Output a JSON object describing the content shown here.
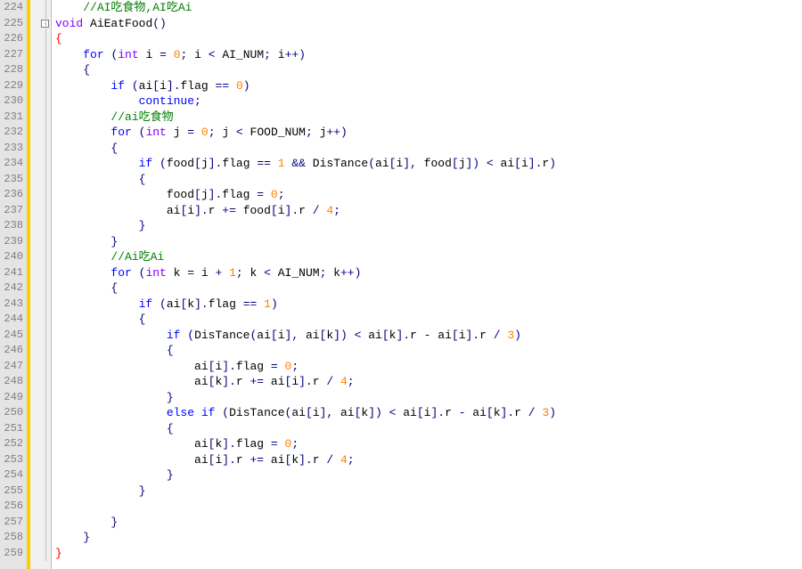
{
  "lineStart": 224,
  "lineEnd": 259,
  "code": {
    "l224": {
      "indent": 1,
      "tokens": [
        {
          "t": "//AI吃食物,AI吃Ai",
          "c": "cmt"
        }
      ]
    },
    "l225": {
      "indent": 0,
      "tokens": [
        {
          "t": "void",
          "c": "type"
        },
        {
          "t": " "
        },
        {
          "t": "AiEatFood",
          "c": "ident"
        },
        {
          "t": "()",
          "c": "paren"
        }
      ]
    },
    "l226": {
      "indent": 0,
      "tokens": [
        {
          "t": "{",
          "c": "br-red"
        }
      ]
    },
    "l227": {
      "indent": 1,
      "tokens": [
        {
          "t": "for",
          "c": "kw"
        },
        {
          "t": " "
        },
        {
          "t": "(",
          "c": "paren"
        },
        {
          "t": "int",
          "c": "type"
        },
        {
          "t": " i "
        },
        {
          "t": "=",
          "c": "op"
        },
        {
          "t": " "
        },
        {
          "t": "0",
          "c": "num"
        },
        {
          "t": ";",
          "c": "punc"
        },
        {
          "t": " i "
        },
        {
          "t": "<",
          "c": "op"
        },
        {
          "t": " AI_NUM"
        },
        {
          "t": ";",
          "c": "punc"
        },
        {
          "t": " i"
        },
        {
          "t": "++)",
          "c": "paren"
        }
      ]
    },
    "l228": {
      "indent": 1,
      "tokens": [
        {
          "t": "{",
          "c": "brace"
        }
      ]
    },
    "l229": {
      "indent": 2,
      "tokens": [
        {
          "t": "if",
          "c": "kw"
        },
        {
          "t": " "
        },
        {
          "t": "(",
          "c": "paren"
        },
        {
          "t": "ai"
        },
        {
          "t": "[",
          "c": "punc"
        },
        {
          "t": "i"
        },
        {
          "t": "].",
          "c": "punc"
        },
        {
          "t": "flag "
        },
        {
          "t": "==",
          "c": "op"
        },
        {
          "t": " "
        },
        {
          "t": "0",
          "c": "num"
        },
        {
          "t": ")",
          "c": "paren"
        }
      ]
    },
    "l230": {
      "indent": 3,
      "tokens": [
        {
          "t": "continue",
          "c": "kw"
        },
        {
          "t": ";",
          "c": "punc"
        }
      ]
    },
    "l231": {
      "indent": 2,
      "tokens": [
        {
          "t": "//ai吃食物",
          "c": "cmt"
        }
      ]
    },
    "l232": {
      "indent": 2,
      "tokens": [
        {
          "t": "for",
          "c": "kw"
        },
        {
          "t": " "
        },
        {
          "t": "(",
          "c": "paren"
        },
        {
          "t": "int",
          "c": "type"
        },
        {
          "t": " j "
        },
        {
          "t": "=",
          "c": "op"
        },
        {
          "t": " "
        },
        {
          "t": "0",
          "c": "num"
        },
        {
          "t": ";",
          "c": "punc"
        },
        {
          "t": " j "
        },
        {
          "t": "<",
          "c": "op"
        },
        {
          "t": " FOOD_NUM"
        },
        {
          "t": ";",
          "c": "punc"
        },
        {
          "t": " j"
        },
        {
          "t": "++)",
          "c": "paren"
        }
      ]
    },
    "l233": {
      "indent": 2,
      "tokens": [
        {
          "t": "{",
          "c": "brace"
        }
      ]
    },
    "l234": {
      "indent": 3,
      "tokens": [
        {
          "t": "if",
          "c": "kw"
        },
        {
          "t": " "
        },
        {
          "t": "(",
          "c": "paren"
        },
        {
          "t": "food"
        },
        {
          "t": "[",
          "c": "punc"
        },
        {
          "t": "j"
        },
        {
          "t": "].",
          "c": "punc"
        },
        {
          "t": "flag "
        },
        {
          "t": "==",
          "c": "op"
        },
        {
          "t": " "
        },
        {
          "t": "1",
          "c": "num"
        },
        {
          "t": " "
        },
        {
          "t": "&&",
          "c": "op"
        },
        {
          "t": " DisTance"
        },
        {
          "t": "(",
          "c": "paren"
        },
        {
          "t": "ai"
        },
        {
          "t": "[",
          "c": "punc"
        },
        {
          "t": "i"
        },
        {
          "t": "],",
          "c": "punc"
        },
        {
          "t": " food"
        },
        {
          "t": "[",
          "c": "punc"
        },
        {
          "t": "j"
        },
        {
          "t": "])",
          "c": "punc"
        },
        {
          "t": " "
        },
        {
          "t": "<",
          "c": "op"
        },
        {
          "t": " ai"
        },
        {
          "t": "[",
          "c": "punc"
        },
        {
          "t": "i"
        },
        {
          "t": "].",
          "c": "punc"
        },
        {
          "t": "r"
        },
        {
          "t": ")",
          "c": "paren"
        }
      ]
    },
    "l235": {
      "indent": 3,
      "tokens": [
        {
          "t": "{",
          "c": "brace"
        }
      ]
    },
    "l236": {
      "indent": 4,
      "tokens": [
        {
          "t": "food"
        },
        {
          "t": "[",
          "c": "punc"
        },
        {
          "t": "j"
        },
        {
          "t": "].",
          "c": "punc"
        },
        {
          "t": "flag "
        },
        {
          "t": "=",
          "c": "op"
        },
        {
          "t": " "
        },
        {
          "t": "0",
          "c": "num"
        },
        {
          "t": ";",
          "c": "punc"
        }
      ]
    },
    "l237": {
      "indent": 4,
      "tokens": [
        {
          "t": "ai"
        },
        {
          "t": "[",
          "c": "punc"
        },
        {
          "t": "i"
        },
        {
          "t": "].",
          "c": "punc"
        },
        {
          "t": "r "
        },
        {
          "t": "+=",
          "c": "op"
        },
        {
          "t": " food"
        },
        {
          "t": "[",
          "c": "punc"
        },
        {
          "t": "i"
        },
        {
          "t": "].",
          "c": "punc"
        },
        {
          "t": "r "
        },
        {
          "t": "/",
          "c": "op"
        },
        {
          "t": " "
        },
        {
          "t": "4",
          "c": "num"
        },
        {
          "t": ";",
          "c": "punc"
        }
      ]
    },
    "l238": {
      "indent": 3,
      "tokens": [
        {
          "t": "}",
          "c": "brace"
        }
      ]
    },
    "l239": {
      "indent": 2,
      "tokens": [
        {
          "t": "}",
          "c": "brace"
        }
      ]
    },
    "l240": {
      "indent": 2,
      "tokens": [
        {
          "t": "//Ai吃Ai",
          "c": "cmt"
        }
      ]
    },
    "l241": {
      "indent": 2,
      "tokens": [
        {
          "t": "for",
          "c": "kw"
        },
        {
          "t": " "
        },
        {
          "t": "(",
          "c": "paren"
        },
        {
          "t": "int",
          "c": "type"
        },
        {
          "t": " k "
        },
        {
          "t": "=",
          "c": "op"
        },
        {
          "t": " i "
        },
        {
          "t": "+",
          "c": "op"
        },
        {
          "t": " "
        },
        {
          "t": "1",
          "c": "num"
        },
        {
          "t": ";",
          "c": "punc"
        },
        {
          "t": " k "
        },
        {
          "t": "<",
          "c": "op"
        },
        {
          "t": " AI_NUM"
        },
        {
          "t": ";",
          "c": "punc"
        },
        {
          "t": " k"
        },
        {
          "t": "++)",
          "c": "paren"
        }
      ]
    },
    "l242": {
      "indent": 2,
      "tokens": [
        {
          "t": "{",
          "c": "brace"
        }
      ]
    },
    "l243": {
      "indent": 3,
      "tokens": [
        {
          "t": "if",
          "c": "kw"
        },
        {
          "t": " "
        },
        {
          "t": "(",
          "c": "paren"
        },
        {
          "t": "ai"
        },
        {
          "t": "[",
          "c": "punc"
        },
        {
          "t": "k"
        },
        {
          "t": "].",
          "c": "punc"
        },
        {
          "t": "flag "
        },
        {
          "t": "==",
          "c": "op"
        },
        {
          "t": " "
        },
        {
          "t": "1",
          "c": "num"
        },
        {
          "t": ")",
          "c": "paren"
        }
      ]
    },
    "l244": {
      "indent": 3,
      "tokens": [
        {
          "t": "{",
          "c": "brace"
        }
      ]
    },
    "l245": {
      "indent": 4,
      "tokens": [
        {
          "t": "if",
          "c": "kw"
        },
        {
          "t": " "
        },
        {
          "t": "(",
          "c": "paren"
        },
        {
          "t": "DisTance"
        },
        {
          "t": "(",
          "c": "paren"
        },
        {
          "t": "ai"
        },
        {
          "t": "[",
          "c": "punc"
        },
        {
          "t": "i"
        },
        {
          "t": "],",
          "c": "punc"
        },
        {
          "t": " ai"
        },
        {
          "t": "[",
          "c": "punc"
        },
        {
          "t": "k"
        },
        {
          "t": "])",
          "c": "punc"
        },
        {
          "t": " "
        },
        {
          "t": "<",
          "c": "op"
        },
        {
          "t": " ai"
        },
        {
          "t": "[",
          "c": "punc"
        },
        {
          "t": "k"
        },
        {
          "t": "].",
          "c": "punc"
        },
        {
          "t": "r "
        },
        {
          "t": "-",
          "c": "op"
        },
        {
          "t": " ai"
        },
        {
          "t": "[",
          "c": "punc"
        },
        {
          "t": "i"
        },
        {
          "t": "].",
          "c": "punc"
        },
        {
          "t": "r "
        },
        {
          "t": "/",
          "c": "op"
        },
        {
          "t": " "
        },
        {
          "t": "3",
          "c": "num"
        },
        {
          "t": ")",
          "c": "paren"
        }
      ]
    },
    "l246": {
      "indent": 4,
      "tokens": [
        {
          "t": "{",
          "c": "brace"
        }
      ]
    },
    "l247": {
      "indent": 5,
      "tokens": [
        {
          "t": "ai"
        },
        {
          "t": "[",
          "c": "punc"
        },
        {
          "t": "i"
        },
        {
          "t": "].",
          "c": "punc"
        },
        {
          "t": "flag "
        },
        {
          "t": "=",
          "c": "op"
        },
        {
          "t": " "
        },
        {
          "t": "0",
          "c": "num"
        },
        {
          "t": ";",
          "c": "punc"
        }
      ]
    },
    "l248": {
      "indent": 5,
      "tokens": [
        {
          "t": "ai"
        },
        {
          "t": "[",
          "c": "punc"
        },
        {
          "t": "k"
        },
        {
          "t": "].",
          "c": "punc"
        },
        {
          "t": "r "
        },
        {
          "t": "+=",
          "c": "op"
        },
        {
          "t": " ai"
        },
        {
          "t": "[",
          "c": "punc"
        },
        {
          "t": "i"
        },
        {
          "t": "].",
          "c": "punc"
        },
        {
          "t": "r "
        },
        {
          "t": "/",
          "c": "op"
        },
        {
          "t": " "
        },
        {
          "t": "4",
          "c": "num"
        },
        {
          "t": ";",
          "c": "punc"
        }
      ]
    },
    "l249": {
      "indent": 4,
      "tokens": [
        {
          "t": "}",
          "c": "brace"
        }
      ]
    },
    "l250": {
      "indent": 4,
      "tokens": [
        {
          "t": "else",
          "c": "kw"
        },
        {
          "t": " "
        },
        {
          "t": "if",
          "c": "kw"
        },
        {
          "t": " "
        },
        {
          "t": "(",
          "c": "paren"
        },
        {
          "t": "DisTance"
        },
        {
          "t": "(",
          "c": "paren"
        },
        {
          "t": "ai"
        },
        {
          "t": "[",
          "c": "punc"
        },
        {
          "t": "i"
        },
        {
          "t": "],",
          "c": "punc"
        },
        {
          "t": " ai"
        },
        {
          "t": "[",
          "c": "punc"
        },
        {
          "t": "k"
        },
        {
          "t": "])",
          "c": "punc"
        },
        {
          "t": " "
        },
        {
          "t": "<",
          "c": "op"
        },
        {
          "t": " ai"
        },
        {
          "t": "[",
          "c": "punc"
        },
        {
          "t": "i"
        },
        {
          "t": "].",
          "c": "punc"
        },
        {
          "t": "r "
        },
        {
          "t": "-",
          "c": "op"
        },
        {
          "t": " ai"
        },
        {
          "t": "[",
          "c": "punc"
        },
        {
          "t": "k"
        },
        {
          "t": "].",
          "c": "punc"
        },
        {
          "t": "r "
        },
        {
          "t": "/",
          "c": "op"
        },
        {
          "t": " "
        },
        {
          "t": "3",
          "c": "num"
        },
        {
          "t": ")",
          "c": "paren"
        }
      ]
    },
    "l251": {
      "indent": 4,
      "tokens": [
        {
          "t": "{",
          "c": "brace"
        }
      ]
    },
    "l252": {
      "indent": 5,
      "tokens": [
        {
          "t": "ai"
        },
        {
          "t": "[",
          "c": "punc"
        },
        {
          "t": "k"
        },
        {
          "t": "].",
          "c": "punc"
        },
        {
          "t": "flag "
        },
        {
          "t": "=",
          "c": "op"
        },
        {
          "t": " "
        },
        {
          "t": "0",
          "c": "num"
        },
        {
          "t": ";",
          "c": "punc"
        }
      ]
    },
    "l253": {
      "indent": 5,
      "tokens": [
        {
          "t": "ai"
        },
        {
          "t": "[",
          "c": "punc"
        },
        {
          "t": "i"
        },
        {
          "t": "].",
          "c": "punc"
        },
        {
          "t": "r "
        },
        {
          "t": "+=",
          "c": "op"
        },
        {
          "t": " ai"
        },
        {
          "t": "[",
          "c": "punc"
        },
        {
          "t": "k"
        },
        {
          "t": "].",
          "c": "punc"
        },
        {
          "t": "r "
        },
        {
          "t": "/",
          "c": "op"
        },
        {
          "t": " "
        },
        {
          "t": "4",
          "c": "num"
        },
        {
          "t": ";",
          "c": "punc"
        }
      ]
    },
    "l254": {
      "indent": 4,
      "tokens": [
        {
          "t": "}",
          "c": "brace"
        }
      ]
    },
    "l255": {
      "indent": 3,
      "tokens": [
        {
          "t": "}",
          "c": "brace"
        }
      ]
    },
    "l256": {
      "indent": 0,
      "tokens": []
    },
    "l257": {
      "indent": 2,
      "tokens": [
        {
          "t": "}",
          "c": "brace"
        }
      ]
    },
    "l258": {
      "indent": 1,
      "tokens": [
        {
          "t": "}",
          "c": "brace"
        }
      ]
    },
    "l259": {
      "indent": 0,
      "tokens": [
        {
          "t": "}",
          "c": "br-red"
        }
      ]
    }
  },
  "fold": {
    "225": "box"
  }
}
